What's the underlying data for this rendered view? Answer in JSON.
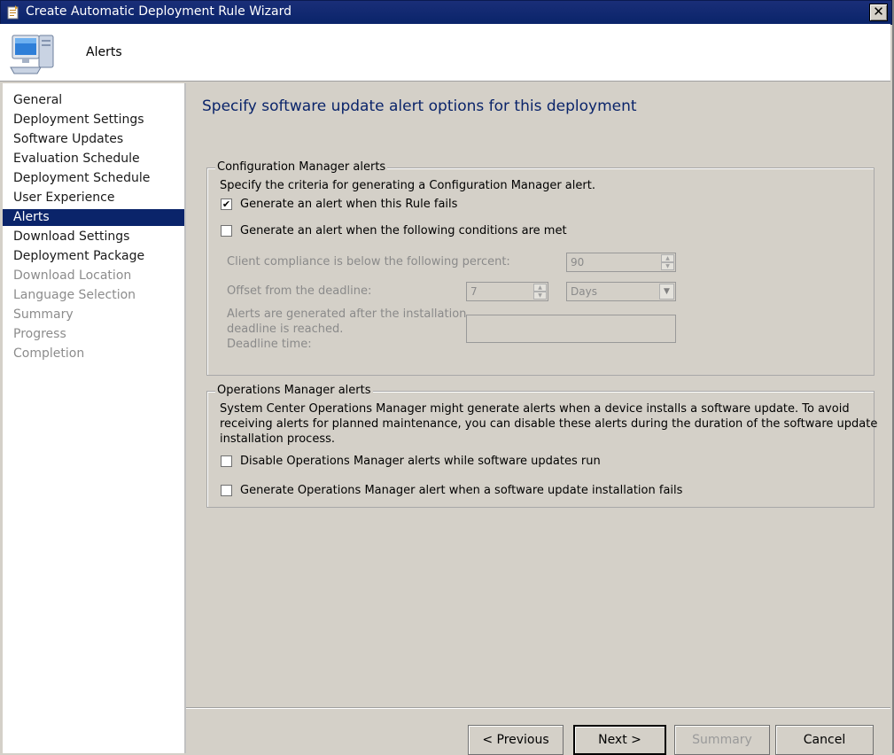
{
  "window": {
    "title": "Create Automatic Deployment Rule Wizard",
    "close_glyph": "✕"
  },
  "header": {
    "title": "Alerts",
    "icon": "computer-icon"
  },
  "sidebar": {
    "items": [
      {
        "label": "General",
        "state": "done"
      },
      {
        "label": "Deployment Settings",
        "state": "done"
      },
      {
        "label": "Software Updates",
        "state": "done"
      },
      {
        "label": "Evaluation Schedule",
        "state": "done"
      },
      {
        "label": "Deployment Schedule",
        "state": "done"
      },
      {
        "label": "User Experience",
        "state": "done"
      },
      {
        "label": "Alerts",
        "state": "active"
      },
      {
        "label": "Download Settings",
        "state": "done"
      },
      {
        "label": "Deployment Package",
        "state": "done"
      },
      {
        "label": "Download Location",
        "state": "future"
      },
      {
        "label": "Language Selection",
        "state": "future"
      },
      {
        "label": "Summary",
        "state": "future"
      },
      {
        "label": "Progress",
        "state": "future"
      },
      {
        "label": "Completion",
        "state": "future"
      }
    ]
  },
  "main": {
    "heading": "Specify software update alert options for this deployment",
    "cm_alerts": {
      "legend": "Configuration Manager alerts",
      "description": "Specify the criteria for generating a Configuration Manager alert.",
      "rule_fails_label": "Generate an alert when this Rule fails",
      "rule_fails_checked": true,
      "check_glyph": "✔",
      "conditions_label": "Generate an alert when the following conditions are met",
      "conditions_checked": false,
      "compliance_label": "Client compliance is below the  following percent:",
      "compliance_value": "90",
      "offset_label": "Offset from the deadline:",
      "offset_value": "7",
      "offset_unit": "Days",
      "deadline_line1": "Alerts are generated after the installation",
      "deadline_line2": "deadline is reached.",
      "deadline_line3": "Deadline time:",
      "deadline_value": ""
    },
    "om_alerts": {
      "legend": "Operations Manager alerts",
      "description_line1": "System Center Operations Manager might generate alerts when a device installs a software update. To avoid",
      "description_line2": "receiving alerts for planned maintenance, you can disable these alerts during the duration of the software update",
      "description_line3": "installation process.",
      "disable_label": "Disable Operations Manager alerts while software updates run",
      "disable_checked": false,
      "generate_label": "Generate Operations Manager alert when a software update installation fails",
      "generate_checked": false
    }
  },
  "footer": {
    "previous": "< Previous",
    "next": "Next >",
    "summary": "Summary",
    "cancel": "Cancel"
  }
}
